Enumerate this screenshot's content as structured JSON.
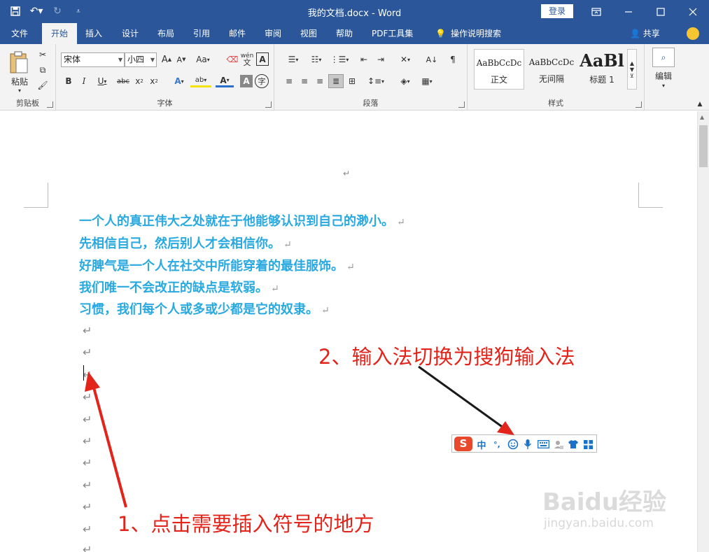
{
  "window": {
    "title": "我的文档.docx  -  Word",
    "login_label": "登录"
  },
  "tabs": [
    {
      "label": "文件"
    },
    {
      "label": "开始"
    },
    {
      "label": "插入"
    },
    {
      "label": "设计"
    },
    {
      "label": "布局"
    },
    {
      "label": "引用"
    },
    {
      "label": "邮件"
    },
    {
      "label": "审阅"
    },
    {
      "label": "视图"
    },
    {
      "label": "帮助"
    },
    {
      "label": "PDF工具集"
    },
    {
      "label": "操作说明搜索"
    }
  ],
  "share_label": "共享",
  "ribbon": {
    "clipboard": {
      "paste_label": "粘贴",
      "group_label": "剪贴板"
    },
    "font": {
      "font_name": "宋体",
      "font_size": "小四",
      "group_label": "字体",
      "aa_label": "Aa",
      "phonetic_label": "wén"
    },
    "paragraph": {
      "group_label": "段落"
    },
    "styles": {
      "group_label": "样式",
      "items": [
        {
          "sample": "AaBbCcDc",
          "name": "正文"
        },
        {
          "sample": "AaBbCcDc",
          "name": "无间隔"
        },
        {
          "sample": "AaBl",
          "name": "标题 1"
        }
      ]
    },
    "editing": {
      "label": "编辑"
    }
  },
  "document": {
    "paragraph_mark": "↵",
    "lines": [
      "一个人的真正伟大之处就在于他能够认识到自己的渺小。",
      "先相信自己，然后别人才会相信你。",
      "好脾气是一个人在社交中所能穿着的最佳服饰。",
      "我们唯一不会改正的缺点是软弱。",
      "习惯，我们每个人或多或少都是它的奴隶。"
    ]
  },
  "ime": {
    "logo": "S",
    "mode": "中",
    "punct": "°,"
  },
  "annotations": {
    "step1": "1、点击需要插入符号的地方",
    "step2": "2、输入法切换为搜狗输入法"
  },
  "watermark": {
    "logo": "Baidu经验",
    "url": "jingyan.baidu.com"
  },
  "colors": {
    "accent": "#2b579a",
    "text_blue": "#29a9e0",
    "annotation_red": "#e3241b",
    "sogou_red": "#e8492c"
  }
}
